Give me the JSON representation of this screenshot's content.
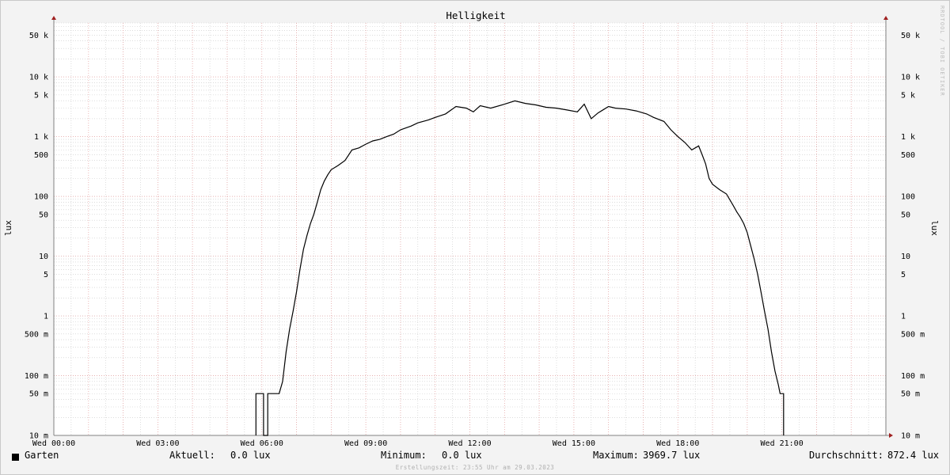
{
  "chart_data": {
    "type": "line",
    "title": "Helligkeit",
    "ylabel": "lux",
    "yscale": "log",
    "ylim": [
      0.01,
      80000
    ],
    "xlim": [
      "Wed 00:00",
      "Wed 24:00"
    ],
    "y_ticks": [
      {
        "value": 50000,
        "label": "50 k"
      },
      {
        "value": 10000,
        "label": "10 k"
      },
      {
        "value": 5000,
        "label": "5 k"
      },
      {
        "value": 1000,
        "label": "1 k"
      },
      {
        "value": 500,
        "label": "500"
      },
      {
        "value": 100,
        "label": "100"
      },
      {
        "value": 50,
        "label": "50"
      },
      {
        "value": 10,
        "label": "10"
      },
      {
        "value": 5,
        "label": "5"
      },
      {
        "value": 1,
        "label": "1"
      },
      {
        "value": 0.5,
        "label": "500 m"
      },
      {
        "value": 0.1,
        "label": "100 m"
      },
      {
        "value": 0.05,
        "label": "50 m"
      },
      {
        "value": 0.01,
        "label": "10 m"
      }
    ],
    "x_ticks": [
      {
        "hour": 0,
        "label": "Wed 00:00"
      },
      {
        "hour": 3,
        "label": "Wed 03:00"
      },
      {
        "hour": 6,
        "label": "Wed 06:00"
      },
      {
        "hour": 9,
        "label": "Wed 09:00"
      },
      {
        "hour": 12,
        "label": "Wed 12:00"
      },
      {
        "hour": 15,
        "label": "Wed 15:00"
      },
      {
        "hour": 18,
        "label": "Wed 18:00"
      },
      {
        "hour": 21,
        "label": "Wed 21:00"
      }
    ],
    "grid": true,
    "series": [
      {
        "name": "Garten",
        "color": "#000000",
        "points": [
          [
            5.83,
            0.01
          ],
          [
            5.83,
            0.05
          ],
          [
            6.05,
            0.05
          ],
          [
            6.05,
            0.01
          ],
          [
            6.17,
            0.01
          ],
          [
            6.17,
            0.05
          ],
          [
            6.5,
            0.05
          ],
          [
            6.6,
            0.08
          ],
          [
            6.7,
            0.25
          ],
          [
            6.8,
            0.6
          ],
          [
            6.9,
            1.2
          ],
          [
            7.0,
            2.5
          ],
          [
            7.1,
            6
          ],
          [
            7.2,
            13
          ],
          [
            7.3,
            22
          ],
          [
            7.4,
            35
          ],
          [
            7.5,
            50
          ],
          [
            7.6,
            80
          ],
          [
            7.7,
            130
          ],
          [
            7.8,
            180
          ],
          [
            7.9,
            230
          ],
          [
            8.0,
            280
          ],
          [
            8.2,
            330
          ],
          [
            8.4,
            400
          ],
          [
            8.6,
            600
          ],
          [
            8.8,
            650
          ],
          [
            9.0,
            750
          ],
          [
            9.2,
            850
          ],
          [
            9.4,
            900
          ],
          [
            9.6,
            1000
          ],
          [
            9.8,
            1100
          ],
          [
            10.0,
            1300
          ],
          [
            10.3,
            1500
          ],
          [
            10.5,
            1700
          ],
          [
            10.8,
            1900
          ],
          [
            11.0,
            2100
          ],
          [
            11.3,
            2400
          ],
          [
            11.6,
            3200
          ],
          [
            11.9,
            3000
          ],
          [
            12.1,
            2600
          ],
          [
            12.3,
            3300
          ],
          [
            12.6,
            3000
          ],
          [
            13.0,
            3500
          ],
          [
            13.3,
            3969.7
          ],
          [
            13.6,
            3600
          ],
          [
            13.9,
            3400
          ],
          [
            14.2,
            3100
          ],
          [
            14.5,
            3000
          ],
          [
            14.8,
            2800
          ],
          [
            15.1,
            2600
          ],
          [
            15.3,
            3500
          ],
          [
            15.5,
            2000
          ],
          [
            15.7,
            2500
          ],
          [
            16.0,
            3200
          ],
          [
            16.2,
            3000
          ],
          [
            16.5,
            2900
          ],
          [
            16.8,
            2700
          ],
          [
            17.1,
            2400
          ],
          [
            17.3,
            2100
          ],
          [
            17.6,
            1800
          ],
          [
            17.8,
            1300
          ],
          [
            18.0,
            1000
          ],
          [
            18.2,
            800
          ],
          [
            18.4,
            600
          ],
          [
            18.6,
            700
          ],
          [
            18.7,
            500
          ],
          [
            18.8,
            350
          ],
          [
            18.9,
            200
          ],
          [
            19.0,
            160
          ],
          [
            19.2,
            130
          ],
          [
            19.4,
            110
          ],
          [
            19.6,
            70
          ],
          [
            19.7,
            55
          ],
          [
            19.8,
            45
          ],
          [
            19.9,
            35
          ],
          [
            20.0,
            25
          ],
          [
            20.1,
            15
          ],
          [
            20.2,
            9
          ],
          [
            20.3,
            5
          ],
          [
            20.4,
            2.5
          ],
          [
            20.5,
            1.2
          ],
          [
            20.6,
            0.6
          ],
          [
            20.7,
            0.25
          ],
          [
            20.8,
            0.12
          ],
          [
            20.9,
            0.07
          ],
          [
            20.95,
            0.05
          ],
          [
            21.05,
            0.05
          ],
          [
            21.05,
            0.01
          ]
        ]
      }
    ]
  },
  "legend": {
    "series_name": "Garten",
    "current_label": "Aktuell:",
    "current_value": "0.0 lux",
    "min_label": "Minimum:",
    "min_value": "0.0 lux",
    "max_label": "Maximum:",
    "max_value": "3969.7 lux",
    "avg_label": "Durchschnitt:",
    "avg_value": "872.4 lux"
  },
  "watermark": "RRDTOOL / TOBI OETIKER",
  "footer": "Erstellungszeit: 23:55 Uhr am 29.03.2023",
  "colors": {
    "background": "#f3f3f3",
    "plot_background": "#ffffff",
    "major_grid": "#e8a0a0",
    "minor_grid": "#c8c8c8",
    "axis": "#808080",
    "arrow": "#a02020",
    "line": "#000000"
  }
}
